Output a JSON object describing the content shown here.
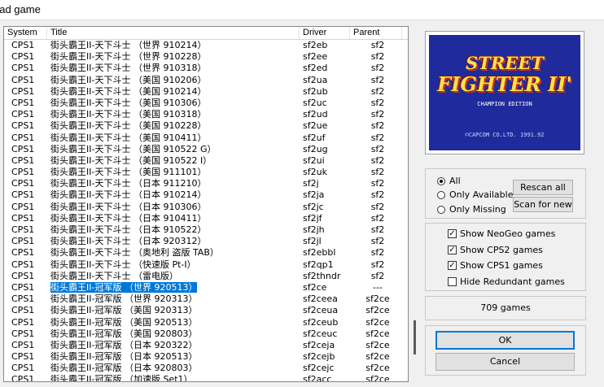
{
  "window": {
    "title": "oad game"
  },
  "columns": {
    "system": "System",
    "title": "Title",
    "driver": "Driver",
    "parent": "Parent"
  },
  "rows": [
    {
      "system": "CPS1",
      "title": "街头霸王II-天下斗士 （世界  910214）",
      "driver": "sf2eb",
      "parent": "sf2"
    },
    {
      "system": "CPS1",
      "title": "街头霸王II-天下斗士 （世界  910228）",
      "driver": "sf2ee",
      "parent": "sf2"
    },
    {
      "system": "CPS1",
      "title": "街头霸王II-天下斗士 （世界  910318）",
      "driver": "sf2ed",
      "parent": "sf2"
    },
    {
      "system": "CPS1",
      "title": "街头霸王II-天下斗士 （美国  910206）",
      "driver": "sf2ua",
      "parent": "sf2"
    },
    {
      "system": "CPS1",
      "title": "街头霸王II-天下斗士 （美国  910214）",
      "driver": "sf2ub",
      "parent": "sf2"
    },
    {
      "system": "CPS1",
      "title": "街头霸王II-天下斗士 （美国  910306）",
      "driver": "sf2uc",
      "parent": "sf2"
    },
    {
      "system": "CPS1",
      "title": "街头霸王II-天下斗士 （美国  910318）",
      "driver": "sf2ud",
      "parent": "sf2"
    },
    {
      "system": "CPS1",
      "title": "街头霸王II-天下斗士 （美国  910228）",
      "driver": "sf2ue",
      "parent": "sf2"
    },
    {
      "system": "CPS1",
      "title": "街头霸王II-天下斗士 （美国  910411）",
      "driver": "sf2uf",
      "parent": "sf2"
    },
    {
      "system": "CPS1",
      "title": "街头霸王II-天下斗士 （美国  910522  G）",
      "driver": "sf2ug",
      "parent": "sf2"
    },
    {
      "system": "CPS1",
      "title": "街头霸王II-天下斗士 （美国  910522  I）",
      "driver": "sf2ui",
      "parent": "sf2"
    },
    {
      "system": "CPS1",
      "title": "街头霸王II-天下斗士 （美国  911101）",
      "driver": "sf2uk",
      "parent": "sf2"
    },
    {
      "system": "CPS1",
      "title": "街头霸王II-天下斗士 （日本  911210）",
      "driver": "sf2j",
      "parent": "sf2"
    },
    {
      "system": "CPS1",
      "title": "街头霸王II-天下斗士 （日本  910214）",
      "driver": "sf2ja",
      "parent": "sf2"
    },
    {
      "system": "CPS1",
      "title": "街头霸王II-天下斗士 （日本  910306）",
      "driver": "sf2jc",
      "parent": "sf2"
    },
    {
      "system": "CPS1",
      "title": "街头霸王II-天下斗士 （日本  910411）",
      "driver": "sf2jf",
      "parent": "sf2"
    },
    {
      "system": "CPS1",
      "title": "街头霸王II-天下斗士 （日本  910522）",
      "driver": "sf2jh",
      "parent": "sf2"
    },
    {
      "system": "CPS1",
      "title": "街头霸王II-天下斗士 （日本  920312）",
      "driver": "sf2jl",
      "parent": "sf2"
    },
    {
      "system": "CPS1",
      "title": "街头霸王II-天下斗士 （奥地利  盗版  TAB）",
      "driver": "sf2ebbl",
      "parent": "sf2"
    },
    {
      "system": "CPS1",
      "title": "街头霸王II-天下斗士 （快速版  Pt-I）",
      "driver": "sf2qp1",
      "parent": "sf2"
    },
    {
      "system": "CPS1",
      "title": "街头霸王II-天下斗士 （雷电版）",
      "driver": "sf2thndr",
      "parent": "sf2"
    },
    {
      "system": "CPS1",
      "title": "街头霸王II-冠军版  （世界  920513）",
      "driver": "sf2ce",
      "parent": "---",
      "selected": true
    },
    {
      "system": "CPS1",
      "title": "街头霸王II-冠军版  （世界  920313）",
      "driver": "sf2ceea",
      "parent": "sf2ce"
    },
    {
      "system": "CPS1",
      "title": "街头霸王II-冠军版  （美国  920313）",
      "driver": "sf2ceua",
      "parent": "sf2ce"
    },
    {
      "system": "CPS1",
      "title": "街头霸王II-冠军版  （美国  920513）",
      "driver": "sf2ceub",
      "parent": "sf2ce"
    },
    {
      "system": "CPS1",
      "title": "街头霸王II-冠军版  （美国  920803）",
      "driver": "sf2ceuc",
      "parent": "sf2ce"
    },
    {
      "system": "CPS1",
      "title": "街头霸王II-冠军版  （日本  920322）",
      "driver": "sf2ceja",
      "parent": "sf2ce"
    },
    {
      "system": "CPS1",
      "title": "街头霸王II-冠军版  （日本  920513）",
      "driver": "sf2cejb",
      "parent": "sf2ce"
    },
    {
      "system": "CPS1",
      "title": "街头霸王II-冠军版  （日本  920803）",
      "driver": "sf2cejc",
      "parent": "sf2ce"
    },
    {
      "system": "CPS1",
      "title": "街头霸王II-冠军版  （加速版  Set1）",
      "driver": "sf2acc",
      "parent": "sf2ce"
    }
  ],
  "preview": {
    "logo_line1": "STREET",
    "logo_line2": "FIGHTER II'",
    "logo_sub": "CHAMPION EDITION",
    "logo_copy": "©CAPCOM CO.LTD.  1991.92",
    "colors": {
      "background": "#1f2b9c",
      "logo": "#f8e24a",
      "logo_shadow": "#c4331f"
    }
  },
  "filter": {
    "all": "All",
    "available": "Only Available",
    "missing": "Only Missing",
    "selected": "all",
    "rescan": "Rescan all",
    "scan_new": "Scan for new"
  },
  "options": {
    "neogeo": "Show NeoGeo games",
    "cps2": "Show CPS2 games",
    "cps1": "Show CPS1 games",
    "hide_redundant": "Hide Redundant games",
    "checked": {
      "neogeo": true,
      "cps2": true,
      "cps1": true,
      "hide_redundant": false
    }
  },
  "count": "709 games",
  "buttons": {
    "ok": "OK",
    "cancel": "Cancel"
  },
  "colors": {
    "selection": "#0078d7",
    "window_bg": "#f0f0f0"
  }
}
